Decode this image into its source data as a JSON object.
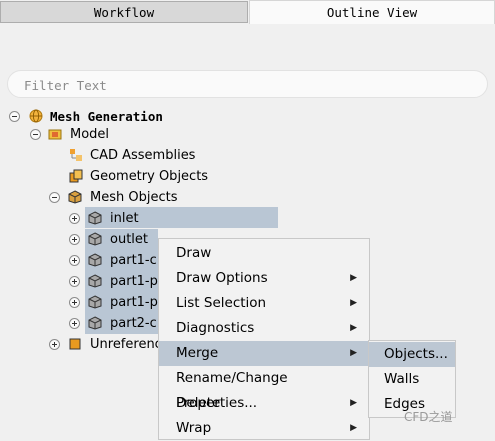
{
  "tabs": {
    "workflow": "Workflow",
    "outline": "Outline View"
  },
  "filter": {
    "placeholder": "Filter Text"
  },
  "tree": {
    "root": "Mesh Generation",
    "model": "Model",
    "cad": "CAD Assemblies",
    "geometry": "Geometry Objects",
    "mesh_objects": "Mesh Objects",
    "objects": [
      "inlet",
      "outlet",
      "part1-c",
      "part1-p",
      "part1-p",
      "part2-c"
    ],
    "unreferenced": "Unreferenc"
  },
  "context_menu": {
    "items": [
      "Draw",
      "Draw Options",
      "List Selection",
      "Diagnostics",
      "Merge",
      "Rename/Change Properties...",
      "Delete",
      "Wrap"
    ],
    "has_submenu": [
      false,
      true,
      true,
      true,
      true,
      false,
      true,
      true
    ],
    "selected": "Merge"
  },
  "submenu": {
    "items": [
      "Objects...",
      "Walls",
      "Edges"
    ],
    "selected": "Objects..."
  },
  "watermark": "CFD之道",
  "colors": {
    "selection": "#b9c6d4",
    "menu_bg": "#f2f2f2"
  }
}
